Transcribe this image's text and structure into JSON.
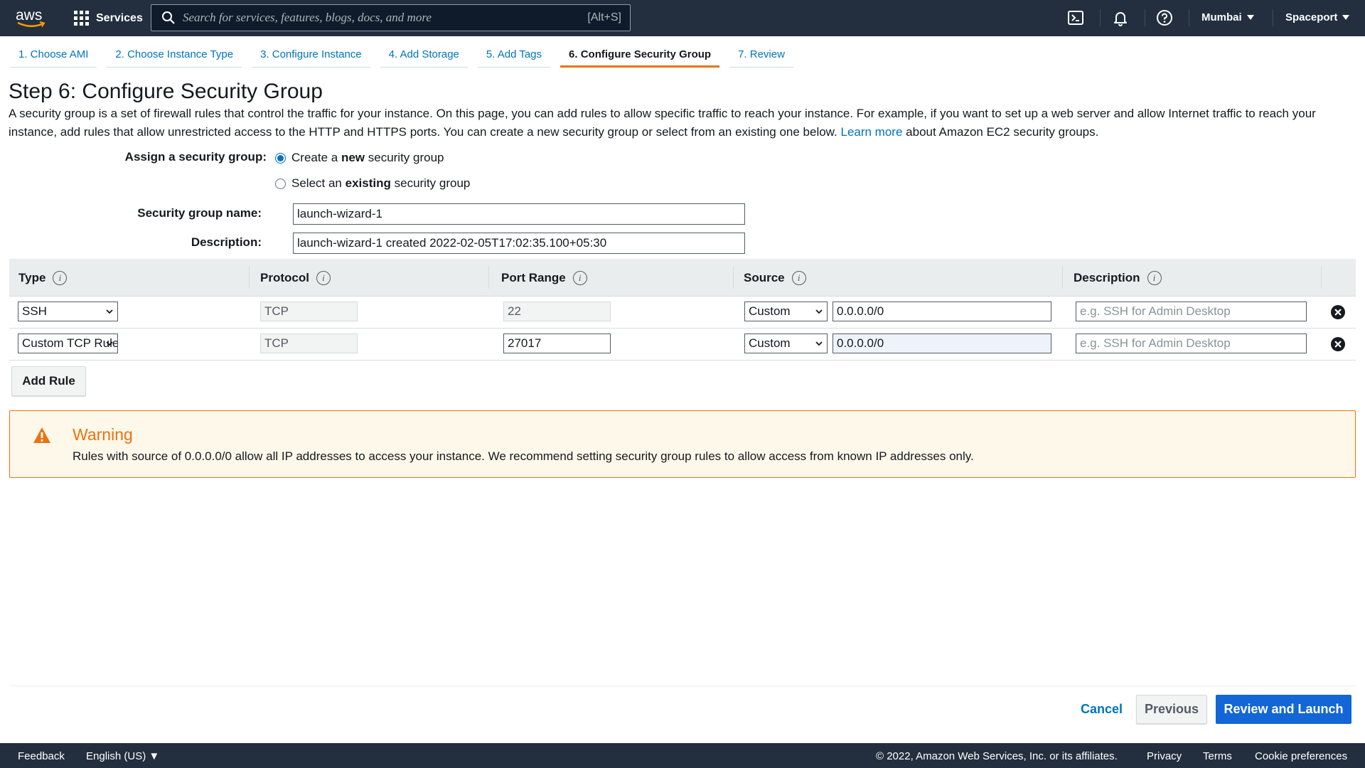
{
  "topnav": {
    "logo_text": "aws",
    "services_label": "Services",
    "search_placeholder": "Search for services, features, blogs, docs, and more",
    "search_shortcut": "[Alt+S]",
    "region": "Mumbai",
    "account": "Spaceport",
    "colors": {
      "bg": "#232f3e",
      "logo_smile": "#ff9900"
    }
  },
  "tabs": [
    {
      "label": "1. Choose AMI",
      "active": false
    },
    {
      "label": "2. Choose Instance Type",
      "active": false
    },
    {
      "label": "3. Configure Instance",
      "active": false
    },
    {
      "label": "4. Add Storage",
      "active": false
    },
    {
      "label": "5. Add Tags",
      "active": false
    },
    {
      "label": "6. Configure Security Group",
      "active": true
    },
    {
      "label": "7. Review",
      "active": false
    }
  ],
  "page": {
    "title": "Step 6: Configure Security Group",
    "intro_text": "A security group is a set of firewall rules that control the traffic for your instance. On this page, you can add rules to allow specific traffic to reach your instance. For example, if you want to set up a web server and allow Internet traffic to reach your instance, add rules that allow unrestricted access to the HTTP and HTTPS ports. You can create a new security group or select from an existing one below.",
    "learn_more": "Learn more",
    "intro_suffix": "about Amazon EC2 security groups."
  },
  "form": {
    "assign_label": "Assign a security group:",
    "option_new_pre": "Create a",
    "option_new_bold": "new",
    "option_new_post": "security group",
    "option_existing_pre": "Select an",
    "option_existing_bold": "existing",
    "option_existing_post": "security group",
    "selected_option": "new",
    "name_label": "Security group name:",
    "name_value": "launch-wizard-1",
    "description_label": "Description:",
    "description_value": "launch-wizard-1 created 2022-02-05T17:02:35.100+05:30"
  },
  "table": {
    "headers": [
      "Type",
      "Protocol",
      "Port Range",
      "Source",
      "Description"
    ],
    "rows": [
      {
        "type": "SSH",
        "protocol": "TCP",
        "port_range": "22",
        "source_type": "Custom",
        "source_cidr": "0.0.0.0/0",
        "description_placeholder": "e.g. SSH for Admin Desktop"
      },
      {
        "type": "Custom TCP Rule",
        "protocol": "TCP",
        "port_range": "27017",
        "source_type": "Custom",
        "source_cidr": "0.0.0.0/0",
        "description_placeholder": "e.g. SSH for Admin Desktop"
      }
    ],
    "add_rule_label": "Add Rule"
  },
  "warning": {
    "title": "Warning",
    "text": "Rules with source of 0.0.0.0/0 allow all IP addresses to access your instance. We recommend setting security group rules to allow access from known IP addresses only.",
    "color": "#ec7211"
  },
  "actions": {
    "cancel": "Cancel",
    "previous": "Previous",
    "review_launch": "Review and Launch",
    "primary_color": "#1266d5"
  },
  "bottombar": {
    "feedback": "Feedback",
    "language": "English (US)",
    "copyright": "© 2022, Amazon Web Services, Inc. or its affiliates.",
    "privacy": "Privacy",
    "terms": "Terms",
    "cookies": "Cookie preferences"
  }
}
